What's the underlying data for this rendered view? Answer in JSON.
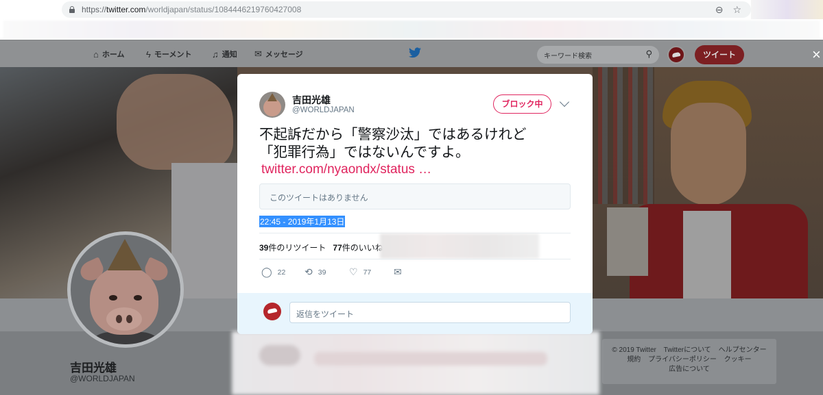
{
  "browser": {
    "url_scheme": "https://",
    "url_host": "twitter.com",
    "url_path": "/worldjapan/status/1084446219760427008",
    "zoom_icon": "zoom-icon",
    "star_icon": "star-icon"
  },
  "nav": {
    "home": "ホーム",
    "moments": "モーメント",
    "notifications": "通知",
    "messages": "メッセージ",
    "search_placeholder": "キーワード検索",
    "tweet_button": "ツイート",
    "close": "×"
  },
  "profile": {
    "name": "吉田光雄",
    "handle": "@WORLDJAPAN"
  },
  "tweet": {
    "name": "吉田光雄",
    "handle": "@WORLDJAPAN",
    "block_label": "ブロック中",
    "text_line1": "不起訴だから「警察沙汰」ではあるけれど",
    "text_line2": "「犯罪行為」ではないんですよ。",
    "link": "twitter.com/nyaondx/status …",
    "quote_unavailable": "このツイートはありません",
    "timestamp": "22:45 - 2019年1月13日",
    "retweets_count": "39",
    "retweets_label": "件のリツイート",
    "likes_count": "77",
    "likes_label": "件のいいね",
    "reply_count": "22",
    "retweet_count": "39",
    "like_count": "77",
    "reply_placeholder": "返信をツイート"
  },
  "footer": {
    "copyright": "© 2019 Twitter",
    "about": "Twitterについて",
    "help": "ヘルプセンター",
    "terms": "規約",
    "privacy": "プライバシーポリシー",
    "cookies": "クッキー",
    "ads": "広告について"
  },
  "colors": {
    "accent_red": "#e0245e",
    "selection_blue": "#3390ff",
    "reply_bg": "#e8f5fd"
  }
}
